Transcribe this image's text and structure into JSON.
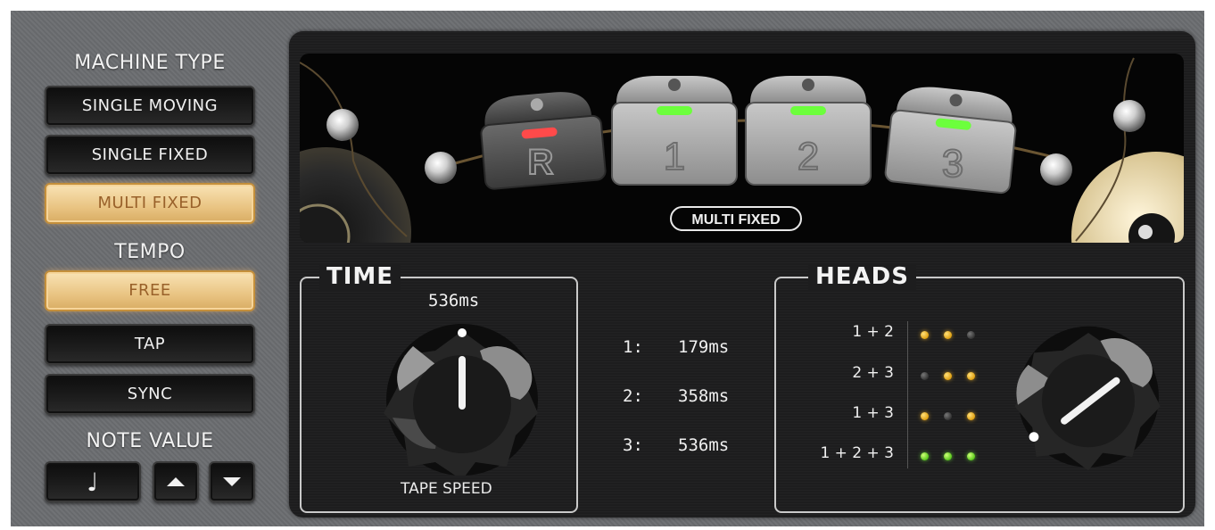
{
  "machine_type": {
    "title": "MACHINE TYPE",
    "options": [
      "SINGLE MOVING",
      "SINGLE FIXED",
      "MULTI FIXED"
    ],
    "selected": "MULTI FIXED"
  },
  "tempo": {
    "title": "TEMPO",
    "options": [
      "FREE",
      "TAP",
      "SYNC"
    ],
    "selected": "FREE"
  },
  "note_value": {
    "title": "NOTE VALUE",
    "note_glyph": "♩",
    "up_icon": "arrow-up-icon",
    "down_icon": "arrow-down-icon"
  },
  "tape_display": {
    "heads": [
      "R",
      "1",
      "2",
      "3"
    ],
    "head_led_colors": [
      "#ff4a4a",
      "#6cff3c",
      "#6cff3c",
      "#6cff3c"
    ],
    "mode_label": "MULTI FIXED"
  },
  "time": {
    "title": "TIME",
    "value": "536ms",
    "knob_label": "TAPE SPEED",
    "taps": [
      {
        "label": "1:",
        "value": "179ms"
      },
      {
        "label": "2:",
        "value": "358ms"
      },
      {
        "label": "3:",
        "value": "536ms"
      }
    ]
  },
  "heads": {
    "title": "HEADS",
    "rows": [
      {
        "label": "1 + 2",
        "leds": [
          "amber",
          "amber",
          "off"
        ]
      },
      {
        "label": "2 + 3",
        "leds": [
          "off",
          "amber",
          "amber"
        ]
      },
      {
        "label": "1 + 3",
        "leds": [
          "amber",
          "off",
          "amber"
        ]
      },
      {
        "label": "1 + 2 + 3",
        "leds": [
          "green",
          "green",
          "green"
        ]
      }
    ]
  },
  "colors": {
    "selected_button": "#e9c483",
    "panel": "#1d1d1e",
    "background": "#6b6d70"
  }
}
